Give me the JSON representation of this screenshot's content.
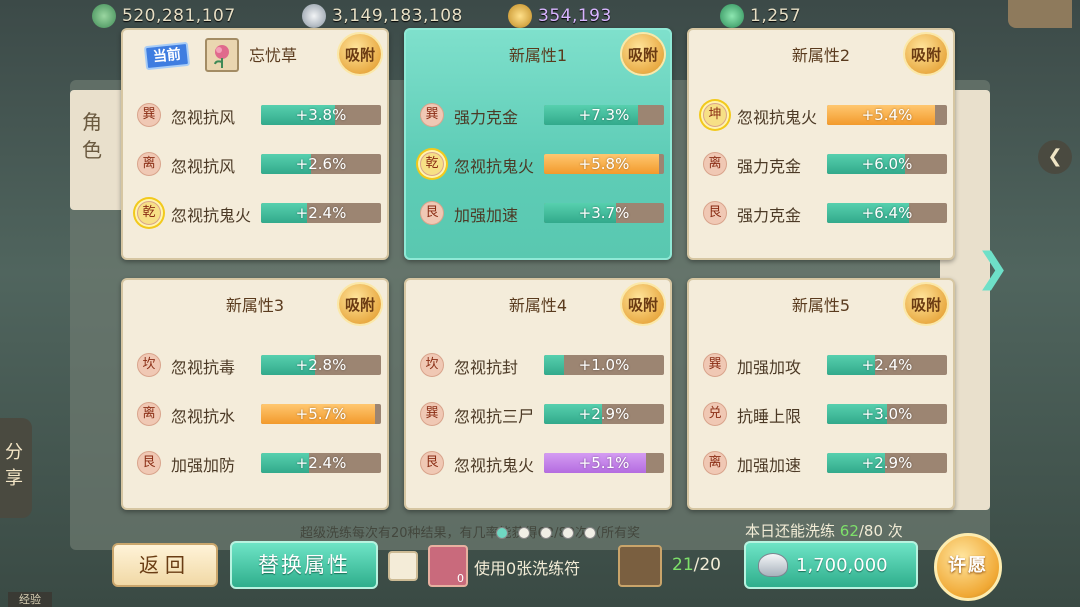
{
  "resources": [
    {
      "icon": "jade-coin-icon",
      "value": "520,281,107"
    },
    {
      "icon": "silver-ingot-icon",
      "value": "3,149,183,108"
    },
    {
      "icon": "gold-coin-icon",
      "value": "354,193"
    },
    {
      "icon": "green-gem-icon",
      "value": "1,257"
    }
  ],
  "background": {
    "left_tab": "角色",
    "share": "分享",
    "exp": "经验"
  },
  "cards": [
    {
      "title": "忘忧草",
      "current_badge": "当前",
      "absorb": "吸附",
      "selected": false,
      "rows": [
        {
          "trigram": "巽",
          "highlight": false,
          "name": "忽视抗风",
          "value": "+3.8%",
          "fill": 0.62,
          "color": "green"
        },
        {
          "trigram": "离",
          "highlight": false,
          "name": "忽视抗风",
          "value": "+2.6%",
          "fill": 0.42,
          "color": "green"
        },
        {
          "trigram": "乾",
          "highlight": true,
          "name": "忽视抗鬼火",
          "value": "+2.4%",
          "fill": 0.38,
          "color": "green"
        }
      ]
    },
    {
      "title": "新属性1",
      "absorb": "吸附",
      "selected": true,
      "rows": [
        {
          "trigram": "巽",
          "highlight": false,
          "name": "强力克金",
          "value": "+7.3%",
          "fill": 0.78,
          "color": "green"
        },
        {
          "trigram": "乾",
          "highlight": true,
          "name": "忽视抗鬼火",
          "value": "+5.8%",
          "fill": 0.96,
          "color": "orange"
        },
        {
          "trigram": "艮",
          "highlight": false,
          "name": "加强加速",
          "value": "+3.7%",
          "fill": 0.6,
          "color": "green"
        }
      ]
    },
    {
      "title": "新属性2",
      "absorb": "吸附",
      "selected": false,
      "rows": [
        {
          "trigram": "坤",
          "highlight": true,
          "name": "忽视抗鬼火",
          "value": "+5.4%",
          "fill": 0.9,
          "color": "orange"
        },
        {
          "trigram": "离",
          "highlight": false,
          "name": "强力克金",
          "value": "+6.0%",
          "fill": 0.65,
          "color": "green"
        },
        {
          "trigram": "艮",
          "highlight": false,
          "name": "强力克金",
          "value": "+6.4%",
          "fill": 0.68,
          "color": "green"
        }
      ]
    },
    {
      "title": "新属性3",
      "absorb": "吸附",
      "selected": false,
      "rows": [
        {
          "trigram": "坎",
          "highlight": false,
          "name": "忽视抗毒",
          "value": "+2.8%",
          "fill": 0.45,
          "color": "green"
        },
        {
          "trigram": "离",
          "highlight": false,
          "name": "忽视抗水",
          "value": "+5.7%",
          "fill": 0.95,
          "color": "orange"
        },
        {
          "trigram": "艮",
          "highlight": false,
          "name": "加强加防",
          "value": "+2.4%",
          "fill": 0.4,
          "color": "green"
        }
      ]
    },
    {
      "title": "新属性4",
      "absorb": "吸附",
      "selected": false,
      "rows": [
        {
          "trigram": "坎",
          "highlight": false,
          "name": "忽视抗封",
          "value": "+1.0%",
          "fill": 0.17,
          "color": "green"
        },
        {
          "trigram": "巽",
          "highlight": false,
          "name": "忽视抗三尸",
          "value": "+2.9%",
          "fill": 0.48,
          "color": "green"
        },
        {
          "trigram": "艮",
          "highlight": false,
          "name": "忽视抗鬼火",
          "value": "+5.1%",
          "fill": 0.85,
          "color": "purple"
        }
      ]
    },
    {
      "title": "新属性5",
      "absorb": "吸附",
      "selected": false,
      "rows": [
        {
          "trigram": "巽",
          "highlight": false,
          "name": "加强加攻",
          "value": "+2.4%",
          "fill": 0.4,
          "color": "green"
        },
        {
          "trigram": "兑",
          "highlight": false,
          "name": "抗睡上限",
          "value": "+3.0%",
          "fill": 0.5,
          "color": "green"
        },
        {
          "trigram": "离",
          "highlight": false,
          "name": "加强加速",
          "value": "+2.9%",
          "fill": 0.48,
          "color": "green"
        }
      ]
    }
  ],
  "bottom": {
    "description": "超级洗练每次有20种结果，有几率能获得62/80次（所有奖",
    "remain_prefix": "本日还能洗练 ",
    "remain_used": "62",
    "remain_total": "/80 次",
    "back_label": "返回",
    "replace_label": "替换属性",
    "fu_count": "0",
    "use_text": "使用0张洗练符",
    "gem_have": "21",
    "gem_need": "/20",
    "cost": "1,700,000",
    "wish_label": "许愿",
    "page_dots": 5,
    "active_dot": 0
  }
}
